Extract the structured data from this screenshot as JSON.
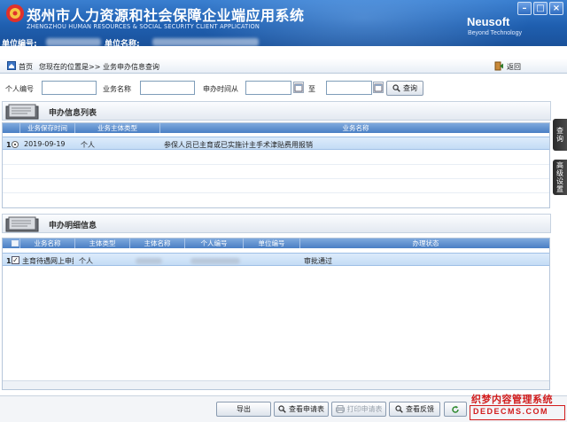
{
  "header": {
    "title": "郑州市人力资源和社会保障企业端应用系统",
    "subtitle": "ZHENGZHOU HUMAN RESOURCES & SOCIAL SECURITY CLIENT APPLICATION",
    "brand": "Neusoft",
    "brand_tagline": "Beyond Technology",
    "unit_code_label": "单位编号:",
    "unit_name_label": "单位名称:",
    "window_buttons": {
      "minimize": "–",
      "maximize": "□",
      "close": "×"
    }
  },
  "breadcrumb": {
    "home": "首页",
    "location_prefix": "您现在的位置是",
    "path": ">> 业务申办信息查询",
    "back": "返回"
  },
  "search": {
    "person_id_label": "个人编号",
    "business_name_label": "业务名称",
    "time_from_label": "申办时间从",
    "to_label": "至",
    "query_button": "查询",
    "person_id_value": "",
    "business_name_value": "",
    "time_from_value": "",
    "time_to_value": ""
  },
  "apply_list": {
    "title": "申办信息列表",
    "columns": [
      "业务保存时间",
      "业务主体类型",
      "业务名称"
    ],
    "rows": [
      {
        "num": "1",
        "time": "2019-09-19",
        "type": "个人",
        "name": "参保人员已主育或已实施计主手术津贴费用报销"
      }
    ]
  },
  "detail_list": {
    "title": "申办明细信息",
    "columns": [
      "业务名称",
      "主体类型",
      "主体名称",
      "个人编号",
      "单位编号",
      "办理状态"
    ],
    "rows": [
      {
        "num": "1",
        "name": "主育待遇网上申报",
        "type": "个人",
        "status": "审批通过"
      }
    ]
  },
  "side_tabs": {
    "query": "查询",
    "advanced": "高级设置"
  },
  "toolbar": {
    "export": "导出",
    "view_application": "查看申请表",
    "print_application": "打印申请表",
    "view_feedback": "查看反馈"
  },
  "watermark": {
    "line1": "织梦内容管理系统",
    "line2": "DEDECMS.COM"
  },
  "colors": {
    "banner": "#1f5fb0",
    "grid_header": "#4a7fc4",
    "selected_row": "#c4dcf5",
    "watermark": "#d21c1c"
  }
}
